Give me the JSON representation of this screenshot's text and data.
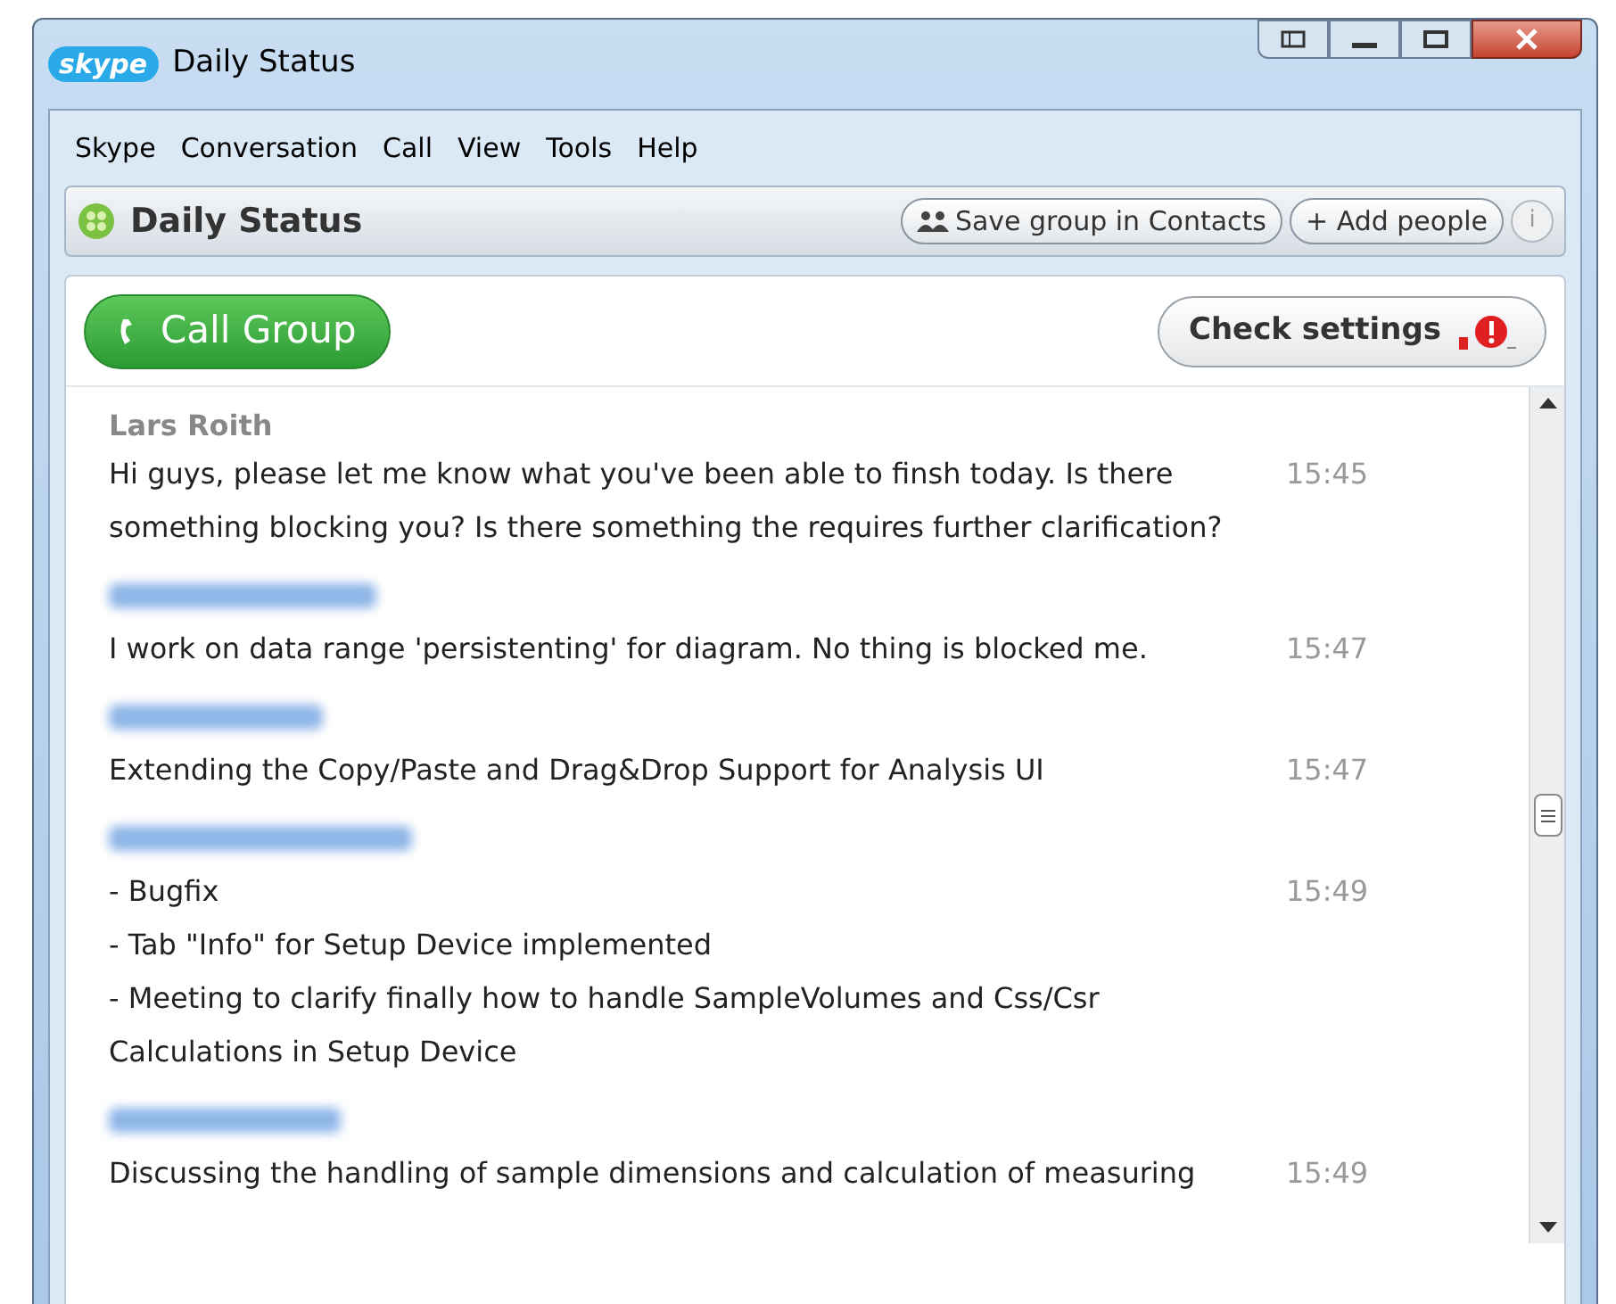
{
  "window": {
    "logo": "skype",
    "title": "Daily Status"
  },
  "menu": [
    "Skype",
    "Conversation",
    "Call",
    "View",
    "Tools",
    "Help"
  ],
  "header": {
    "title": "Daily Status",
    "buttons": [
      {
        "kind": "save",
        "label": "Save group in Contacts"
      },
      {
        "kind": "add",
        "label": "+ Add people"
      }
    ],
    "info": "i"
  },
  "call_button": "Call Group",
  "check_settings": {
    "label": "Check settings",
    "warning": true
  },
  "messages": [
    {
      "sender_blurred": false,
      "sender": "Lars Roith",
      "text": "Hi guys, please let me know what you've been able to finsh today. Is there something blocking you? Is there something the requires further clarification?",
      "time": "15:45"
    },
    {
      "sender_blurred": true,
      "text": "I work on data range 'persistenting' for diagram. No thing is blocked me.",
      "time": "15:47"
    },
    {
      "sender_blurred": true,
      "text": "Extending the Copy/Paste and Drag&Drop Support for Analysis UI",
      "time": "15:47"
    },
    {
      "sender_blurred": true,
      "text": "- Bugfix\n- Tab \"Info\" for Setup Device implemented\n- Meeting to clarify finally how to handle SampleVolumes and Css/Csr Calculations in Setup Device",
      "time": "15:49"
    },
    {
      "sender_blurred": true,
      "text": "Discussing the handling of sample dimensions and calculation of measuring",
      "time": "15:49"
    }
  ]
}
